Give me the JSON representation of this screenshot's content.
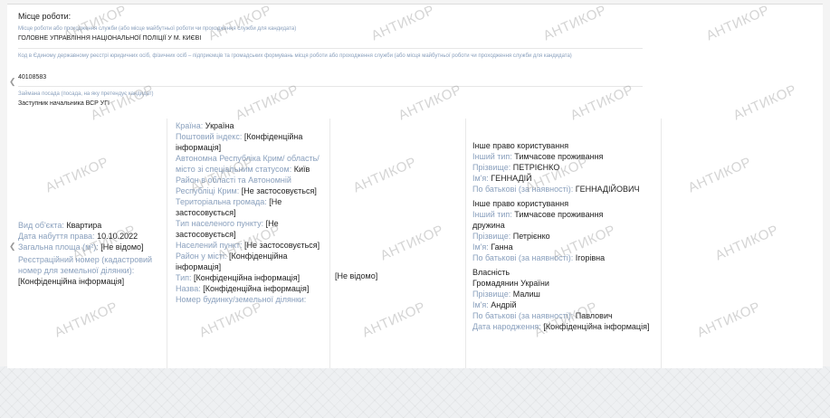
{
  "section_title": "Місце роботи:",
  "workplace": {
    "label": "Місце роботи або проходження служби (або місце майбутньої роботи чи проходження служби для кандидата)",
    "value": "ГОЛОВНЕ УПРАВЛІННЯ НАЦІОНАЛЬНОЇ ПОЛІЦІЇ У М. КИЄВІ"
  },
  "edrpou": {
    "label": "Код в Єдиному державному реєстрі юридичних осіб, фізичних осіб – підприємців та громадських формувань місця роботи або проходження служби (або місця майбутньої роботи чи проходження служби для кандидата)",
    "value": "40108583"
  },
  "position": {
    "label": "Займана посада (посада, на яку претендує кандидат)",
    "value": "Заступник начальника ВСР УГІ"
  },
  "object": {
    "type_label": "Вид об'єкта:",
    "type_value": "Квартира",
    "date_label": "Дата набуття права:",
    "date_value": "10.10.2022",
    "area_label": "Загальна площа (м²):",
    "area_value": "[Не відомо]",
    "reg_label": "Реєстраційний номер (кадастровий номер для земельної ділянки):",
    "reg_value": "[Конфіденційна інформація]"
  },
  "address": [
    {
      "label": "Країна:",
      "value": "Україна"
    },
    {
      "label": "Поштовий індекс:",
      "value": "[Конфіденційна інформація]"
    },
    {
      "label": "Автономна Республіка Крим/ область/місто зі спеціальним статусом:",
      "value": "Київ"
    },
    {
      "label": "Район в області та Автономній Республіці Крим:",
      "value": "[Не застосовується]"
    },
    {
      "label": "Територіальна громада:",
      "value": "[Не застосовується]"
    },
    {
      "label": "Тип населеного пункту:",
      "value": "[Не застосовується]"
    },
    {
      "label": "Населений пункт:",
      "value": "[Не застосовується]"
    },
    {
      "label": "Район у місті:",
      "value": "[Конфіденційна інформація]"
    },
    {
      "label": "Тип:",
      "value": "[Конфіденційна інформація]"
    },
    {
      "label": "Назва:",
      "value": "[Конфіденційна інформація]"
    },
    {
      "label": "Номер будинку/земельної ділянки:",
      "value": ""
    }
  ],
  "cost": "[Не відомо]",
  "rights": {
    "r1": {
      "title": "Інше право користування",
      "type_label": "Інший тип:",
      "type_value": "Тимчасове проживання",
      "surname_label": "Прізвище:",
      "surname_value": "ПЕТРІЄНКО",
      "name_label": "Ім'я:",
      "name_value": "ГЕННАДІЙ",
      "patr_label": "По батькові (за наявності):",
      "patr_value": "ГЕННАДІЙОВИЧ"
    },
    "r2": {
      "title": "Інше право користування",
      "type_label": "Інший тип:",
      "type_value": "Тимчасове проживання",
      "type_value2": "дружина",
      "surname_label": "Прізвище:",
      "surname_value": "Петрієнко",
      "name_label": "Ім'я:",
      "name_value": "Ганна",
      "patr_label": "По батькові (за наявності):",
      "patr_value": "Ігорівна"
    },
    "r3": {
      "title": "Власність",
      "citizen": "Громадянин України",
      "surname_label": "Прізвище:",
      "surname_value": "Малиш",
      "name_label": "Ім'я:",
      "name_value": "Андрій",
      "patr_label": "По батькові (за наявності):",
      "patr_value": "Павлович",
      "dob_label": "Дата народження:",
      "dob_value": "[Конфіденційна інформація]"
    }
  },
  "watermark_text": "АНТИКОР"
}
